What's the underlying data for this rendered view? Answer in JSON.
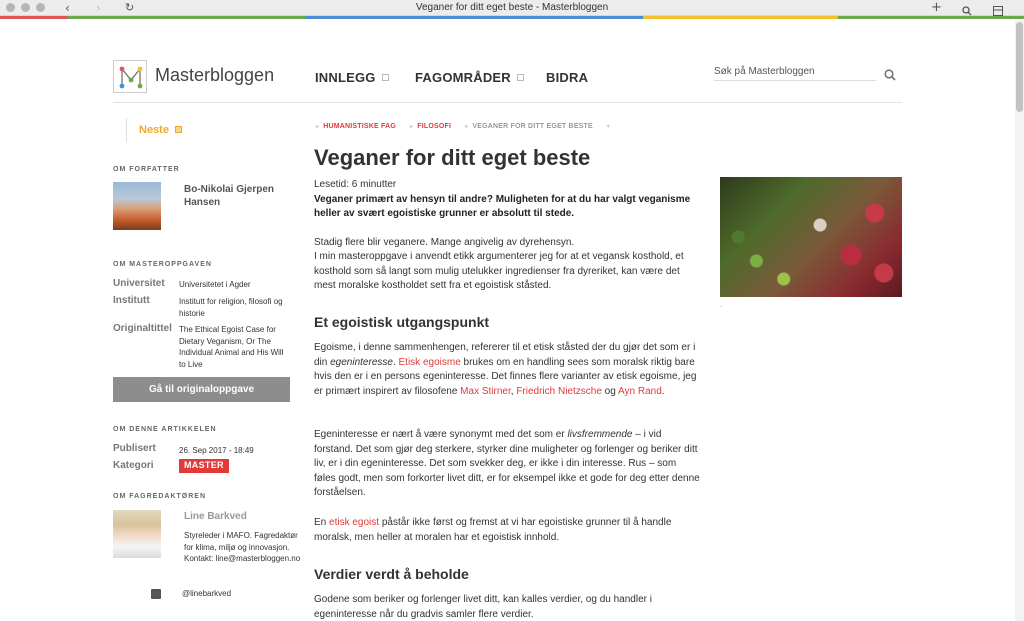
{
  "browser": {
    "window_title": "Veganer for ditt eget beste - Masterbloggen",
    "back_glyph": "‹",
    "forward_glyph": "›",
    "reload_glyph": "↻",
    "newtab_glyph": "+",
    "colors": [
      "#e15656",
      "#6aaa4b",
      "#4a8fd6",
      "#f2c02a",
      "#4ab0b8"
    ]
  },
  "header": {
    "site_name": "Masterbloggen",
    "nav": [
      {
        "label": "INNLEGG"
      },
      {
        "label": "FAGOMRÅDER"
      },
      {
        "label": "BIDRA"
      }
    ],
    "search_placeholder": "Søk på Masterbloggen"
  },
  "sidebar": {
    "next_label": "Neste",
    "about_author_heading": "OM FORFATTER",
    "author_name": "Bo-Nikolai Gjerpen Hansen",
    "about_thesis_heading": "OM MASTEROPPGAVEN",
    "thesis": {
      "university_label": "Universitet",
      "university_value": "Universitetet i Agder",
      "institute_label": "Institutt",
      "institute_value": "Institutt for religion, filosofi og historie",
      "title_label": "Originaltittel",
      "title_value": "The Ethical Egoist Case for Dietary Veganism, Or The Individual Animal and His Will to Live"
    },
    "original_button": "Gå til originaloppgave",
    "about_article_heading": "OM DENNE ARTIKKELEN",
    "published_label": "Publisert",
    "published_value": "26. Sep 2017 - 18:49",
    "category_label": "Kategori",
    "category_value": "MASTER",
    "about_editor_heading": "OM FAGREDAKTØREN",
    "editor_name": "Line Barkved",
    "editor_desc": "Styreleder i MAFO. Fagredaktør for klima, miljø og innovasjon. Kontakt: line@masterbloggen.no",
    "twitter_handle": "@linebarkved"
  },
  "article": {
    "breadcrumbs": [
      "HUMANISTISKE FAG",
      "FILOSOFI",
      "VEGANER FOR DITT EGET BESTE"
    ],
    "title": "Veganer for ditt eget beste",
    "read_time": "Lesetid: 6 minutter",
    "lead": "Veganer primært av hensyn til andre? Muligheten for at du har valgt veganisme heller av svært egoistiske grunner er absolutt til stede.",
    "intro_1": "Stadig flere blir veganere. Mange angivelig av dyrehensyn.",
    "intro_2": "I min masteroppgave i anvendt etikk argumenterer jeg for at et vegansk kosthold, et kosthold som så langt som mulig utelukker ingredienser fra dyreriket, kan være det mest moralske kostholdet sett fra et egoistisk ståsted.",
    "h_1": "Et egoistisk utgangspunkt",
    "p1_a": "Egoisme, i denne sammenhengen, refererer til et etisk ståsted der du gjør det som er i din ",
    "p1_em": "egeninteresse",
    "p1_b": ". ",
    "p1_link1": "Etisk egoisme",
    "p1_c": " brukes om en handling sees som moralsk riktig bare hvis den er i en persons egeninteresse. Det finnes flere varianter av etisk egoisme, jeg er primært inspirert av filosofene ",
    "p1_link2": "Max Stirner",
    "p1_d": ", ",
    "p1_link3": "Friedrich Nietzsche",
    "p1_e": " og ",
    "p1_link4": "Ayn Rand",
    "p1_f": ".",
    "p2_a": "Egeninteresse er nært å være synonymt med det som er ",
    "p2_em": "livsfremmende",
    "p2_b": " – i vid forstand. Det som gjør deg sterkere, styrker dine muligheter og forlenger og beriker ditt liv, er i din egeninteresse. Det som svekker deg, er ikke i din interesse. Rus – som føles godt, men som forkorter livet ditt, er for eksempel ikke et gode for deg etter denne forståelsen.",
    "p3_a": "En ",
    "p3_link": "etisk egoist",
    "p3_b": " påstår ikke først og fremst at vi har egoistiske grunner til å handle moralsk, men heller at moralen har et egoistisk innhold.",
    "h_2": "Verdier verdt å beholde",
    "p4": "Godene som beriker og forlenger livet ditt, kan kalles verdier, og du handler i egeninteresse når du gradvis samler flere verdier.",
    "image_caption": "."
  }
}
